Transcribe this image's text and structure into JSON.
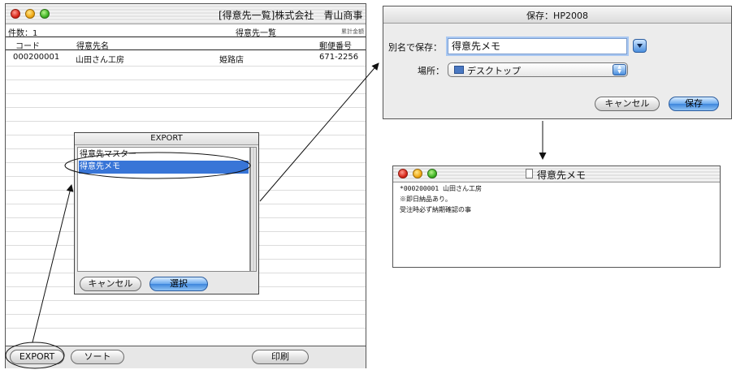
{
  "main_window": {
    "title": "[得意先一覧]株式会社　青山商事",
    "count_label": "件数：1",
    "list_title": "得意先一覧",
    "corner_label": "累計金額",
    "columns": [
      "コード",
      "得意先名",
      "郵便番号"
    ],
    "rows": [
      {
        "code": "000200001",
        "name": "山田さん工房",
        "branch": "姫路店",
        "zip": "671-2256"
      }
    ],
    "buttons": {
      "export": "EXPORT",
      "sort": "ソート",
      "print": "印刷"
    }
  },
  "export_dialog": {
    "title": "EXPORT",
    "items": [
      "得意先マスター",
      "得意先メモ"
    ],
    "selected_index": 1,
    "buttons": {
      "cancel": "キャンセル",
      "select": "選択"
    }
  },
  "save_dialog": {
    "title": "保存：HP2008",
    "name_label": "別名で保存：",
    "name_value": "得意先メモ",
    "location_label": "場所：",
    "location_value": "デスクトップ",
    "buttons": {
      "cancel": "キャンセル",
      "save": "保存"
    }
  },
  "memo_window": {
    "title": "得意先メモ",
    "lines": [
      "*000200001 山田さん工房",
      "※即日納品あり。",
      "受注時必ず納期確認の事"
    ]
  },
  "colors": {
    "selection": "#3875d7",
    "accent_blue": "#4b8fde"
  }
}
